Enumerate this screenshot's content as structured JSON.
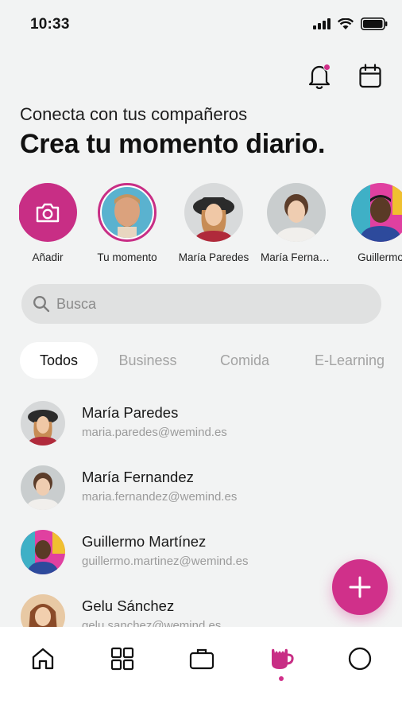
{
  "status_bar": {
    "time": "10:33"
  },
  "header": {
    "subtitle": "Conecta con tus compañeros",
    "title": "Crea tu momento diario."
  },
  "stories": [
    {
      "label": "Añadir",
      "icon": "camera-icon"
    },
    {
      "label": "Tu momento"
    },
    {
      "label": "María Paredes"
    },
    {
      "label": "María Fernandez"
    },
    {
      "label": "Guillermo"
    }
  ],
  "search": {
    "placeholder": "Busca"
  },
  "tabs": [
    "Todos",
    "Business",
    "Comida",
    "E-Learning"
  ],
  "contacts": [
    {
      "name": "María Paredes",
      "email": "maria.paredes@wemind.es"
    },
    {
      "name": "María Fernandez",
      "email": "maria.fernandez@wemind.es"
    },
    {
      "name": "Guillermo Martínez",
      "email": "guillermo.martinez@wemind.es"
    },
    {
      "name": "Gelu Sánchez",
      "email": "gelu.sanchez@wemind.es"
    }
  ],
  "bottom_nav": [
    "home-icon",
    "grid-icon",
    "briefcase-icon",
    "coffee-icon",
    "circle-icon"
  ],
  "colors": {
    "accent": "#d0308a",
    "background": "#f2f3f3"
  }
}
